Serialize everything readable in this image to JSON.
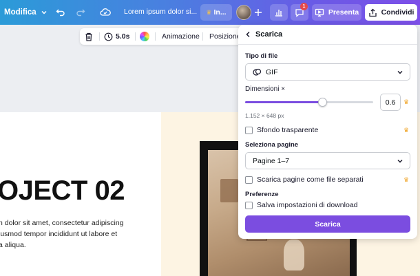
{
  "topbar": {
    "menu_label": "Modifica",
    "doc_title": "Lorem ipsum dolor si...",
    "insights_label": "In...",
    "notification_count": "1",
    "present_label": "Presenta",
    "share_label": "Condividi",
    "gradient": [
      "#2b9bd8",
      "#7d4fe8"
    ]
  },
  "subtoolbar": {
    "duration": "5.0s",
    "animation_label": "Animazione",
    "position_label": "Posizione"
  },
  "canvas": {
    "headline": "OJECT 02",
    "body_lines": [
      "n dolor sit amet, consectetur adipiscing",
      "iusmod tempor incididunt ut labore et",
      "a aliqua."
    ]
  },
  "panel": {
    "title": "Scarica",
    "file_type_label": "Tipo di file",
    "file_type_value": "GIF",
    "size_label": "Dimensioni ×",
    "size_value": "0.6",
    "size_level": 0.6,
    "size_hint": "1.152 × 648 px",
    "transparent_label": "Sfondo trasparente",
    "pages_label": "Seleziona pagine",
    "pages_value": "Pagine 1–7",
    "separate_files_label": "Scarica pagine come file separati",
    "preferences_label": "Preferenze",
    "save_settings_label": "Salva impostazioni di download",
    "download_button": "Scarica",
    "accent": "#7b4de0",
    "crown_color": "#f0a528"
  }
}
